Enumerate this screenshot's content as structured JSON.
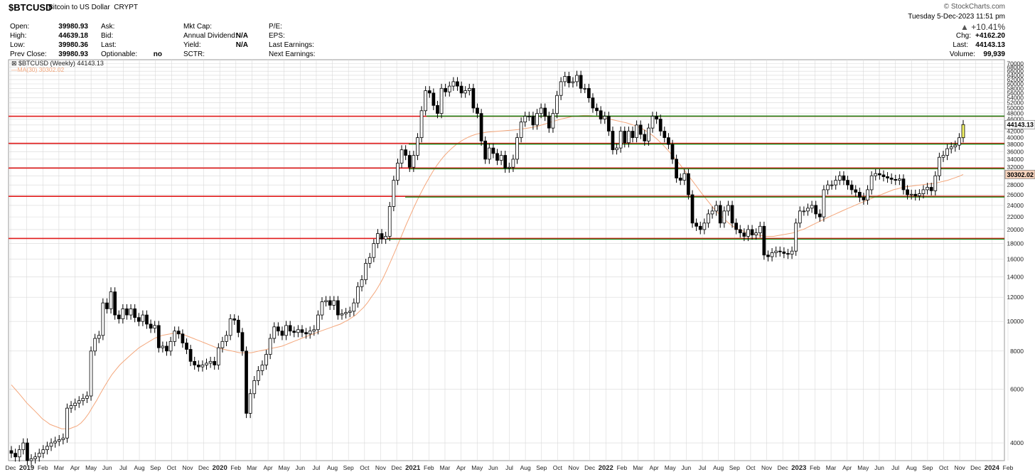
{
  "header": {
    "symbol": "$BTCUSD",
    "name": "Bitcoin to US Dollar",
    "exchange": "CRYPT",
    "brand": "© StockCharts.com",
    "datetime": "Tuesday  5-Dec-2023  11:51 pm",
    "pct_change": "+10.41%",
    "chg_label": "Chg:",
    "chg_value": "+4162.20",
    "last_label": "Last:",
    "last_value": "44143.13",
    "volume_label": "Volume:",
    "volume_value": "99,939",
    "col1": [
      {
        "label": "Open:",
        "value": "39980.93"
      },
      {
        "label": "High:",
        "value": "44639.18"
      },
      {
        "label": "Low:",
        "value": "39980.36"
      },
      {
        "label": "Prev Close:",
        "value": "39980.93"
      }
    ],
    "col2": [
      {
        "label": "Ask:",
        "value": ""
      },
      {
        "label": "Bid:",
        "value": ""
      },
      {
        "label": "Last:",
        "value": ""
      },
      {
        "label": "Optionable:",
        "value": "no"
      }
    ],
    "col3": [
      {
        "label": "Mkt Cap:",
        "value": ""
      },
      {
        "label": "Annual Dividend:",
        "value": "N/A"
      },
      {
        "label": "Yield:",
        "value": "N/A"
      },
      {
        "label": "SCTR:",
        "value": ""
      }
    ],
    "col4": [
      {
        "label": "P/E:",
        "value": ""
      },
      {
        "label": "EPS:",
        "value": ""
      },
      {
        "label": "Last Earnings:",
        "value": ""
      },
      {
        "label": "Next Earnings:",
        "value": ""
      }
    ]
  },
  "colors": {
    "up_candle": "#ffffff",
    "down_candle": "#000000",
    "ma_line": "#f4a77c",
    "red_level": "#e01a1a",
    "green_level": "#1a8a1a",
    "grid": "#d8d8d8",
    "last_highlight": "#f5f56a"
  },
  "chart_data": {
    "type": "candlestick",
    "title": "$BTCUSD (Weekly) 44143.13",
    "ma_label": "MA(30) 30302.02",
    "y_scale": "log",
    "ylim": [
      3500,
      72000
    ],
    "y_ticks": [
      4000,
      6000,
      8000,
      10000,
      12000,
      14000,
      16000,
      18000,
      20000,
      22000,
      24000,
      26000,
      28000,
      30000,
      32000,
      34000,
      36000,
      38000,
      40000,
      42000,
      44000,
      46000,
      48000,
      50000,
      52000,
      54000,
      56000,
      58000,
      60000,
      62000,
      64000,
      66000,
      68000,
      70000
    ],
    "last_price_label": "44143.13",
    "ma_price_label": "30302.02",
    "x_labels": [
      "Dec",
      "2019",
      "Feb",
      "Mar",
      "Apr",
      "May",
      "Jun",
      "Jul",
      "Aug",
      "Sep",
      "Oct",
      "Nov",
      "Dec",
      "2020",
      "Feb",
      "Mar",
      "Apr",
      "May",
      "Jun",
      "Jul",
      "Aug",
      "Sep",
      "Oct",
      "Nov",
      "Dec",
      "2021",
      "Feb",
      "Mar",
      "Apr",
      "May",
      "Jun",
      "Jul",
      "Aug",
      "Sep",
      "Oct",
      "Nov",
      "Dec",
      "2022",
      "Feb",
      "Mar",
      "Apr",
      "May",
      "Jun",
      "Jul",
      "Aug",
      "Sep",
      "Oct",
      "Nov",
      "Dec",
      "2023",
      "Feb",
      "Mar",
      "Apr",
      "May",
      "Jun",
      "Jul",
      "Aug",
      "Sep",
      "Oct",
      "Nov",
      "Dec",
      "2024",
      "Feb"
    ],
    "levels_red": [
      47000,
      38300,
      31800,
      25700,
      18700
    ],
    "levels_green": [
      47300,
      38300,
      31800,
      25700,
      18700
    ],
    "weekly_close": [
      3700,
      3600,
      3800,
      4000,
      3500,
      3550,
      3600,
      3700,
      3800,
      3900,
      4000,
      4050,
      4100,
      4150,
      5200,
      5300,
      5400,
      5500,
      5600,
      5700,
      8000,
      8800,
      9000,
      11500,
      11000,
      12500,
      10500,
      10200,
      11000,
      10500,
      11000,
      10300,
      10000,
      10500,
      9800,
      9500,
      9700,
      8200,
      8300,
      8000,
      8600,
      9300,
      9100,
      8500,
      8100,
      7400,
      7200,
      7100,
      7200,
      7300,
      7400,
      7200,
      8200,
      8600,
      9000,
      10200,
      10100,
      9200,
      8000,
      5000,
      5800,
      6400,
      6900,
      7200,
      7800,
      8800,
      9600,
      9300,
      9000,
      9700,
      9300,
      9200,
      9400,
      9200,
      9100,
      9300,
      9400,
      10500,
      11600,
      11700,
      11300,
      11700,
      10500,
      10600,
      10700,
      10800,
      11500,
      13000,
      13700,
      15500,
      16200,
      18000,
      19400,
      18600,
      19000,
      23800,
      29000,
      33000,
      36500,
      35000,
      32000,
      35000,
      40000,
      49000,
      57000,
      56000,
      51000,
      48000,
      58000,
      56500,
      59000,
      61000,
      59000,
      56000,
      57000,
      58000,
      50000,
      48000,
      39000,
      34000,
      37000,
      35500,
      33700,
      35000,
      31800,
      32000,
      34000,
      40000,
      45000,
      47000,
      47000,
      44000,
      48000,
      50000,
      47000,
      43000,
      48000,
      55000,
      61000,
      63500,
      60500,
      61000,
      64000,
      58000,
      58000,
      54000,
      50000,
      49000,
      46000,
      47000,
      42000,
      36500,
      37000,
      42000,
      38500,
      42000,
      40000,
      44000,
      41000,
      39000,
      43000,
      47000,
      46000,
      42000,
      40000,
      38000,
      34000,
      29500,
      29000,
      30500,
      26000,
      21000,
      20500,
      20000,
      21000,
      22500,
      23000,
      24000,
      21000,
      23000,
      24000,
      21000,
      20000,
      19500,
      19000,
      20000,
      19200,
      19500,
      20500,
      16500,
      16300,
      16800,
      17000,
      16900,
      16700,
      16600,
      17000,
      21000,
      23000,
      23000,
      23500,
      24000,
      22500,
      22000,
      27000,
      28000,
      28000,
      29000,
      30000,
      29000,
      28000,
      27000,
      26500,
      25500,
      25000,
      27000,
      30000,
      30500,
      30200,
      29800,
      29500,
      29200,
      29000,
      29300,
      27000,
      26000,
      26100,
      25800,
      26200,
      27000,
      27500,
      26800,
      30000,
      34500,
      35000,
      36800,
      37300,
      37800,
      39980,
      44143
    ],
    "ma30": [
      6200,
      6000,
      5800,
      5600,
      5400,
      5250,
      5100,
      4950,
      4800,
      4700,
      4600,
      4550,
      4500,
      4450,
      4450,
      4450,
      4500,
      4550,
      4650,
      4800,
      5000,
      5250,
      5500,
      5800,
      6100,
      6400,
      6700,
      6950,
      7200,
      7400,
      7600,
      7800,
      8000,
      8200,
      8350,
      8500,
      8650,
      8800,
      8900,
      9000,
      9050,
      9100,
      9150,
      9150,
      9100,
      9000,
      8900,
      8800,
      8700,
      8600,
      8500,
      8400,
      8300,
      8200,
      8150,
      8100,
      8050,
      8000,
      7950,
      7900,
      7900,
      7900,
      7900,
      7950,
      8000,
      8050,
      8100,
      8150,
      8200,
      8250,
      8300,
      8400,
      8500,
      8600,
      8700,
      8800,
      8900,
      9000,
      9100,
      9200,
      9300,
      9400,
      9500,
      9600,
      9700,
      9800,
      9950,
      10100,
      10300,
      10500,
      10800,
      11100,
      11500,
      12000,
      12500,
      13100,
      13800,
      14700,
      15700,
      16800,
      18000,
      19300,
      20700,
      22100,
      23600,
      25100,
      26600,
      28100,
      29600,
      31100,
      32500,
      33800,
      35000,
      36100,
      37100,
      38000,
      38800,
      39500,
      40100,
      40600,
      41000,
      41300,
      41500,
      41700,
      41800,
      41900,
      42000,
      42100,
      42200,
      42300,
      42400,
      42500,
      42700,
      42900,
      43100,
      43300,
      43600,
      44000,
      44400,
      44800,
      45200,
      45600,
      46000,
      46300,
      46600,
      46900,
      47100,
      47200,
      47300,
      47300,
      47200,
      47000,
      46800,
      46500,
      46200,
      45900,
      45600,
      45300,
      45000,
      44700,
      44300,
      43900,
      43400,
      42800,
      42100,
      41300,
      40400,
      39400,
      38300,
      37200,
      36000,
      34800,
      33600,
      32400,
      31200,
      30000,
      28900,
      27800,
      26700,
      25700,
      24800,
      23900,
      23100,
      22400,
      21800,
      21200,
      20700,
      20300,
      20000,
      19800,
      19600,
      19400,
      19300,
      19200,
      19100,
      19000,
      19000,
      19000,
      19100,
      19200,
      19300,
      19400,
      19500,
      19700,
      19900,
      20100,
      20400,
      20700,
      21000,
      21300,
      21600,
      21900,
      22200,
      22500,
      22800,
      23100,
      23400,
      23700,
      24000,
      24300,
      24600,
      24900,
      25200,
      25500,
      25800,
      26100,
      26400,
      26700,
      27000,
      27200,
      27400,
      27600,
      27700,
      27800,
      27900,
      28000,
      28100,
      28200,
      28300,
      28400,
      28600,
      28800,
      29000,
      29300,
      29600,
      29900,
      30302
    ]
  }
}
